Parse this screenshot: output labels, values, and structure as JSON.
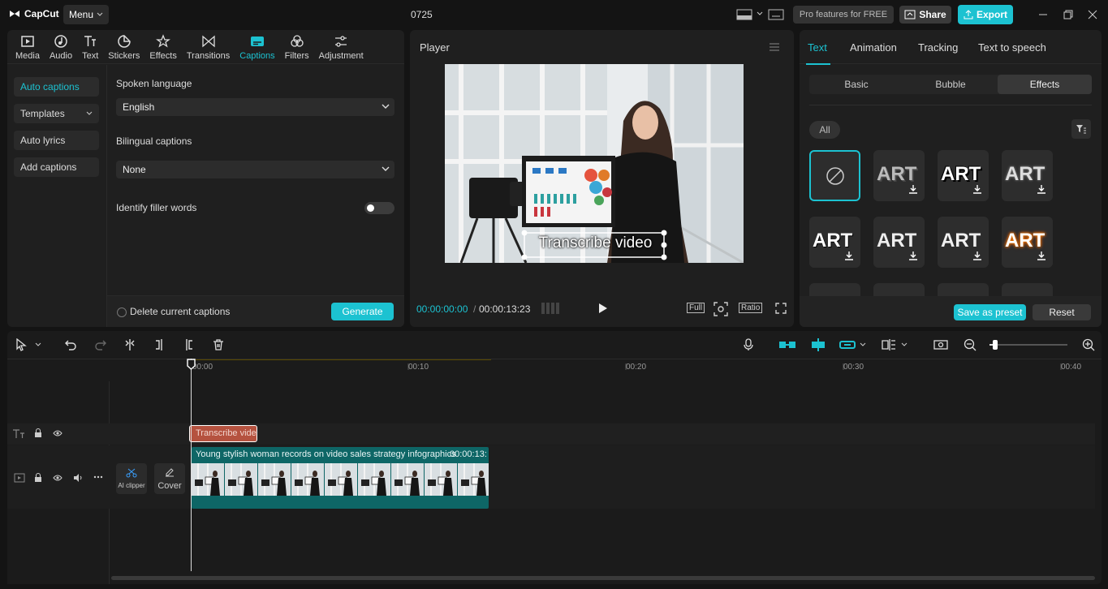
{
  "titlebar": {
    "app_name": "CapCut",
    "menu_label": "Menu",
    "project_title": "0725",
    "pro_label": "Pro features for FREE",
    "share_label": "Share",
    "export_label": "Export"
  },
  "tools": [
    {
      "label": "Media",
      "icon": "media-icon"
    },
    {
      "label": "Audio",
      "icon": "audio-icon"
    },
    {
      "label": "Text",
      "icon": "text-icon"
    },
    {
      "label": "Stickers",
      "icon": "stickers-icon"
    },
    {
      "label": "Effects",
      "icon": "effects-icon"
    },
    {
      "label": "Transitions",
      "icon": "transitions-icon"
    },
    {
      "label": "Captions",
      "icon": "captions-icon",
      "active": true
    },
    {
      "label": "Filters",
      "icon": "filters-icon"
    },
    {
      "label": "Adjustment",
      "icon": "adjustment-icon"
    }
  ],
  "captions_nav": [
    "Auto captions",
    "Templates",
    "Auto lyrics",
    "Add captions"
  ],
  "captions_form": {
    "spoken_language_label": "Spoken language",
    "spoken_language_value": "English",
    "bilingual_label": "Bilingual captions",
    "bilingual_value": "None",
    "filler_label": "Identify filler words",
    "delete_label": "Delete current captions",
    "generate_label": "Generate"
  },
  "player": {
    "title": "Player",
    "caption_overlay": "Transcribe video",
    "current_time": "00:00:00:00",
    "separator": "/",
    "total_time": "00:00:13:23",
    "full_label": "Full",
    "ratio_label": "Ratio"
  },
  "right_panel": {
    "tabs": [
      "Text",
      "Animation",
      "Tracking",
      "Text to speech"
    ],
    "style_tabs": [
      "Basic",
      "Bubble",
      "Effects"
    ],
    "filter_chip": "All",
    "tile_label": "ART",
    "save_preset_label": "Save as preset",
    "reset_label": "Reset"
  },
  "timeline": {
    "ruler": [
      "00:00",
      "00:10",
      "00:20",
      "00:30",
      "00:40"
    ],
    "text_clip": "Transcribe video",
    "video_clip_title": "Young stylish woman records on video sales strategy infographics",
    "video_clip_duration": "00:00:13:",
    "ai_clipper_label": "AI clipper",
    "cover_label": "Cover"
  },
  "colors": {
    "accent": "#1cc2d1",
    "text_clip": "#b5523f",
    "video_clip": "#0e6666"
  }
}
